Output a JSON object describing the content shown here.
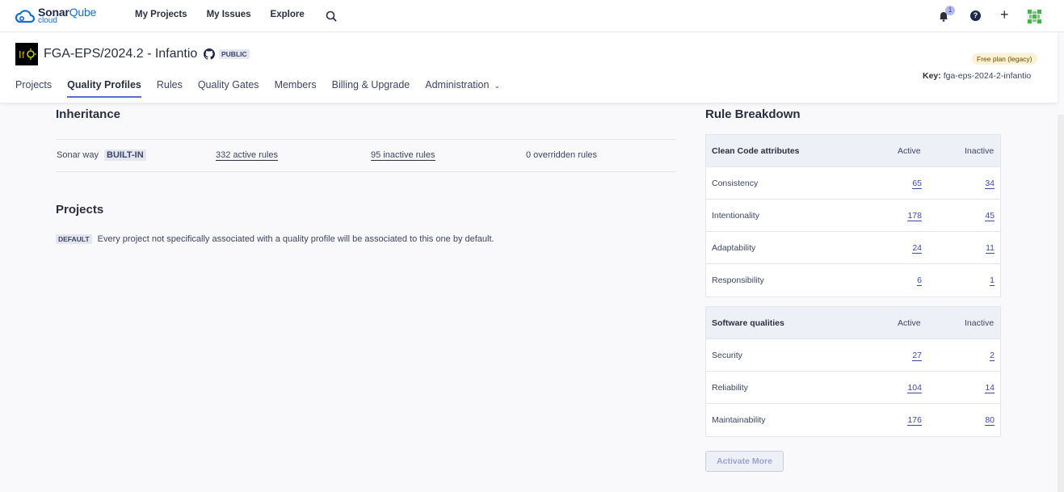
{
  "topbar": {
    "logo_line1_a": "Sonar",
    "logo_line1_b": "Qube",
    "logo_line2": "cloud",
    "nav": [
      "My Projects",
      "My Issues",
      "Explore"
    ],
    "notification_count": "1",
    "help_glyph": "?",
    "plus_glyph": "+",
    "icons": {
      "search": "search-icon",
      "bell": "bell-icon",
      "help": "help-icon",
      "plus": "plus-icon",
      "avatar": "user-avatar"
    }
  },
  "project": {
    "title": "FGA-EPS/2024.2 - Infantio",
    "visibility": "PUBLIC",
    "plan": "Free plan (legacy)",
    "key_label": "Key:",
    "key_value": "fga-eps-2024-2-infantio",
    "tabs": [
      "Projects",
      "Quality Profiles",
      "Rules",
      "Quality Gates",
      "Members",
      "Billing & Upgrade",
      "Administration"
    ],
    "active_tab": "Quality Profiles"
  },
  "inheritance": {
    "title": "Inheritance",
    "profile_name": "Sonar way",
    "profile_badge": "BUILT-IN",
    "active_rules": "332 active rules",
    "inactive_rules": "95 inactive rules",
    "overridden_rules": "0 overridden rules"
  },
  "projects": {
    "title": "Projects",
    "default_badge": "DEFAULT",
    "default_text": "Every project not specifically associated with a quality profile will be associated to this one by default."
  },
  "rule_breakdown": {
    "title": "Rule Breakdown",
    "clean_code": {
      "header": "Clean Code attributes",
      "active_label": "Active",
      "inactive_label": "Inactive",
      "rows": [
        {
          "name": "Consistency",
          "active": "65",
          "inactive": "34"
        },
        {
          "name": "Intentionality",
          "active": "178",
          "inactive": "45"
        },
        {
          "name": "Adaptability",
          "active": "24",
          "inactive": "11"
        },
        {
          "name": "Responsibility",
          "active": "6",
          "inactive": "1"
        }
      ]
    },
    "software_qualities": {
      "header": "Software qualities",
      "active_label": "Active",
      "inactive_label": "Inactive",
      "rows": [
        {
          "name": "Security",
          "active": "27",
          "inactive": "2"
        },
        {
          "name": "Reliability",
          "active": "104",
          "inactive": "14"
        },
        {
          "name": "Maintainability",
          "active": "176",
          "inactive": "80"
        }
      ]
    },
    "activate_button": "Activate More"
  },
  "colors": {
    "accent": "#5d6cd0",
    "link": "#3c4aa8",
    "header_bg": "#eef0f8"
  }
}
